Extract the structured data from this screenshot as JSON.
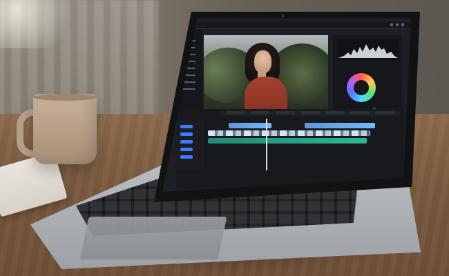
{
  "scene": {
    "objects": [
      "coffee-mug",
      "laptop",
      "notebook",
      "wooden-desk",
      "window-curtain"
    ]
  },
  "screen": {
    "application": "video-editor",
    "panels": [
      "left-menu",
      "video-preview",
      "scopes-and-color-controls",
      "timeline"
    ],
    "colors": {
      "accent": "#3c8fff",
      "timeline_green": "#2bb892",
      "timeline_blue": "#75b7ff",
      "subject_top": "#a4412f"
    }
  }
}
